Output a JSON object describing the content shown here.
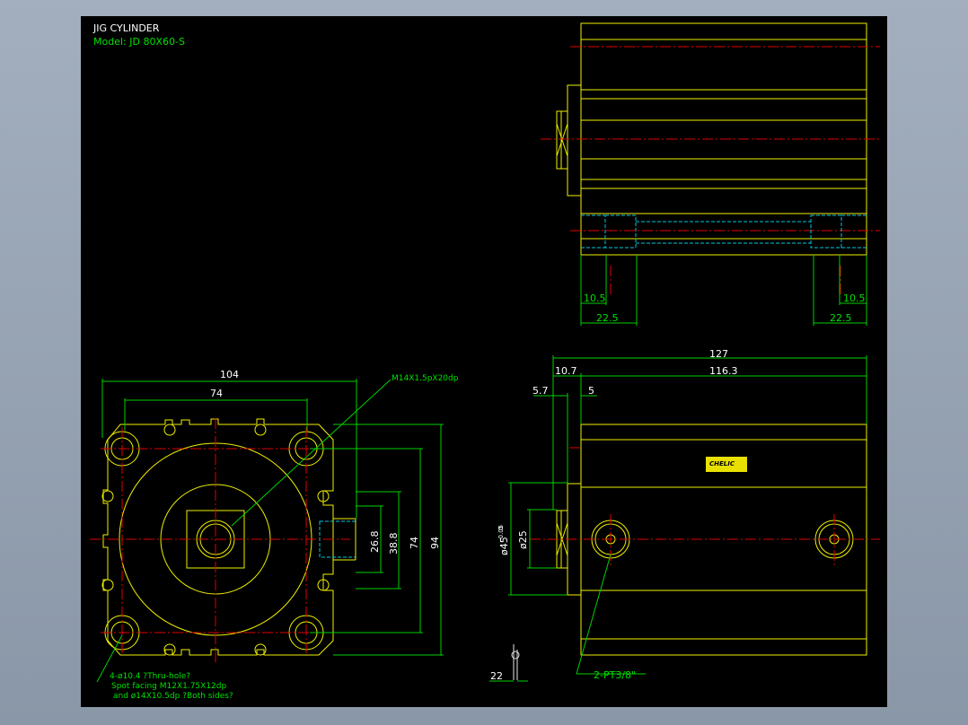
{
  "title": "JIG CYLINDER",
  "model": "Model: JD 80X60-S",
  "dimensions": {
    "front_width": "104",
    "front_hole_pitch": "74",
    "front_height": "94",
    "front_hole_pitch_v": "74",
    "port_38": "38.8",
    "port_26": "26.8",
    "rod_thread": "M14X1.5pX20dp",
    "top_left_10": "10.5",
    "top_right_10": "10.5",
    "top_left_22": "22.5",
    "top_right_22": "22.5",
    "side_total": "127",
    "side_body": "116.3",
    "side_10": "10.7",
    "side_57": "5.7",
    "side_5": "5",
    "side_dia45": "ø45",
    "side_tol": "-0.05",
    "side_tol0": "0",
    "side_dia25": "ø25",
    "side_22": "22",
    "port_spec": "2-PT3/8\""
  },
  "notes": {
    "holes_line1": "4-ø10.4 ?Thru-hole?",
    "holes_line2": "Spot facing  M12X1.75X12dp",
    "holes_line3": "and ø14X10.5dp ?Both sides?"
  },
  "label": {
    "brand": "CHELIC"
  },
  "colors": {
    "outline": "#f0f000",
    "dimension": "#00d000",
    "centerline": "#e00000",
    "hidden": "#00c8e0",
    "background": "#000000"
  }
}
